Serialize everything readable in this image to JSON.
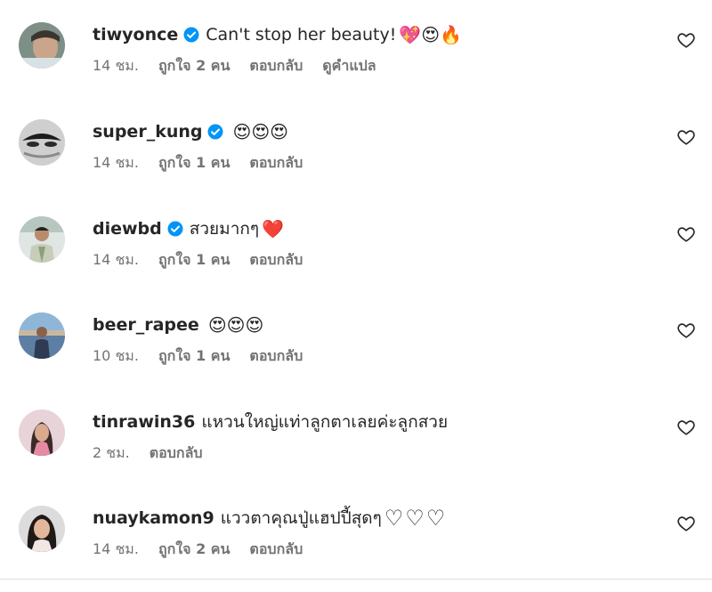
{
  "comments": [
    {
      "username": "tiwyonce",
      "verified": true,
      "text": "Can't stop her beauty!",
      "emojis": "💖😍🔥",
      "time": "14 ชม.",
      "likes": "ถูกใจ 2 คน",
      "reply": "ตอบกลับ",
      "translate": "ดูคำแปล"
    },
    {
      "username": "super_kung",
      "verified": true,
      "text": "",
      "emojis": "😍😍😍",
      "time": "14 ชม.",
      "likes": "ถูกใจ 1 คน",
      "reply": "ตอบกลับ"
    },
    {
      "username": "diewbd",
      "verified": true,
      "text": "สวยมากๆ",
      "emojis": "❤️",
      "time": "14 ชม.",
      "likes": "ถูกใจ 1 คน",
      "reply": "ตอบกลับ"
    },
    {
      "username": "beer_rapee",
      "verified": false,
      "text": "",
      "emojis": "😍😍😍",
      "time": "10 ชม.",
      "likes": "ถูกใจ 1 คน",
      "reply": "ตอบกลับ"
    },
    {
      "username": "tinrawin36",
      "verified": false,
      "text": "แหวนใหญ่แท่าลูกตาเลยค่ะลูกสวย",
      "emojis": "",
      "time": "2 ชม.",
      "reply": "ตอบกลับ"
    },
    {
      "username": "nuaykamon9",
      "verified": false,
      "text": "แววตาคุณปู่แฮปปี้สุดๆ",
      "emojis": "♡♡♡",
      "time": "14 ชม.",
      "likes": "ถูกใจ 2 คน",
      "reply": "ตอบกลับ"
    }
  ],
  "icons": {
    "verified": "verified-badge-icon",
    "like": "heart-outline-icon"
  },
  "colors": {
    "verified": "#0095f6",
    "meta_text": "#737373",
    "main_text": "#262626"
  }
}
